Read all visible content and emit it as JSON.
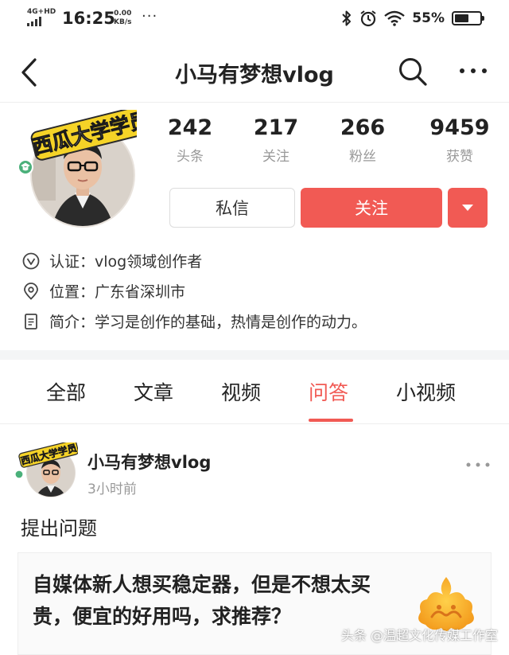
{
  "status_bar": {
    "network": "4G+HD",
    "time": "16:25",
    "speed_value": "0.00",
    "speed_unit": "KB/s",
    "more": "···",
    "battery": "55%",
    "battery_level": 0.55
  },
  "nav": {
    "title": "小马有梦想vlog",
    "icons": [
      "chevron-left-icon",
      "search-icon",
      "more-icon"
    ]
  },
  "profile": {
    "avatar_badge": "西瓜大学学员",
    "stats": [
      {
        "value": "242",
        "label": "头条"
      },
      {
        "value": "217",
        "label": "关注"
      },
      {
        "value": "266",
        "label": "粉丝"
      },
      {
        "value": "9459",
        "label": "获赞"
      }
    ],
    "message_button": "私信",
    "follow_button": "关注",
    "info": [
      {
        "icon": "verified-icon",
        "key": "认证：",
        "value": "vlog领域创作者"
      },
      {
        "icon": "location-icon",
        "key": "位置：",
        "value": "广东省深圳市"
      },
      {
        "icon": "document-icon",
        "key": "简介：",
        "value": "学习是创作的基础，热情是创作的动力。"
      }
    ]
  },
  "tabs": [
    {
      "label": "全部",
      "active": false
    },
    {
      "label": "文章",
      "active": false
    },
    {
      "label": "视频",
      "active": false
    },
    {
      "label": "问答",
      "active": true
    },
    {
      "label": "小视频",
      "active": false
    }
  ],
  "post": {
    "avatar_badge": "西瓜大学学员",
    "author": "小马有梦想vlog",
    "time": "3小时前",
    "action": "提出问题",
    "question": "自媒体新人想买稳定器，但是不想太买贵，便宜的好用吗，求推荐？"
  },
  "watermark": "头条 @温超文化传媒工作室",
  "colors": {
    "accent": "#f15a54",
    "badge_yellow": "#f5d327",
    "muted": "#999999"
  }
}
